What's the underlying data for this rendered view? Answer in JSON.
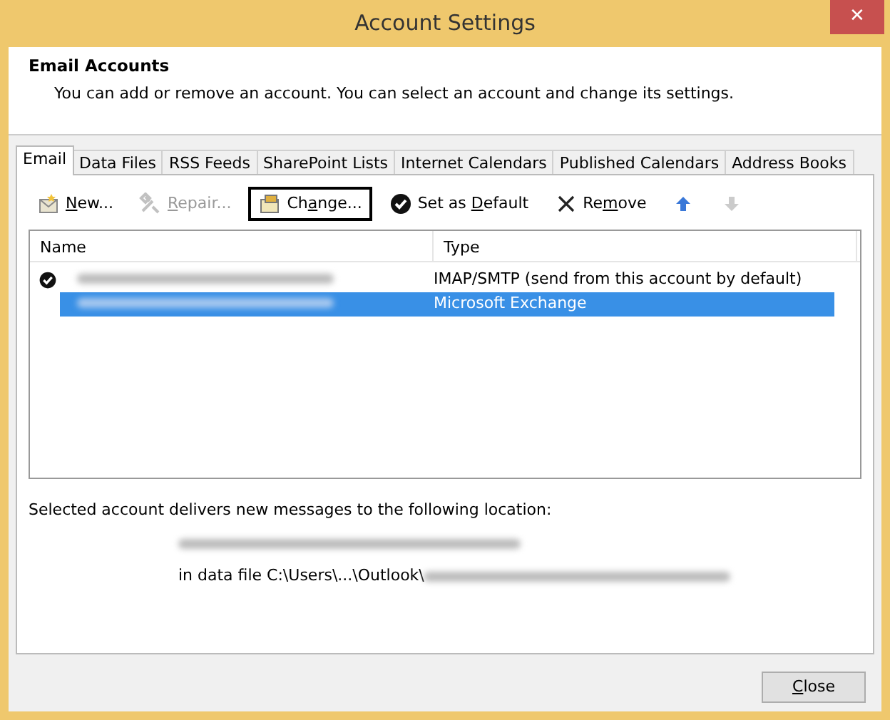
{
  "window": {
    "title": "Account Settings",
    "close_glyph": "✕"
  },
  "header": {
    "title": "Email Accounts",
    "description": "You can add or remove an account. You can select an account and change its settings."
  },
  "tabs": [
    {
      "label": "Email",
      "selected": true
    },
    {
      "label": "Data Files",
      "selected": false
    },
    {
      "label": "RSS Feeds",
      "selected": false
    },
    {
      "label": "SharePoint Lists",
      "selected": false
    },
    {
      "label": "Internet Calendars",
      "selected": false
    },
    {
      "label": "Published Calendars",
      "selected": false
    },
    {
      "label": "Address Books",
      "selected": false
    }
  ],
  "toolbar": [
    {
      "kind": "new",
      "label_parts": {
        "key": "N",
        "after": "ew..."
      },
      "disabled": false,
      "focused": false
    },
    {
      "kind": "repair",
      "label_parts": {
        "key": "R",
        "after": "epair..."
      },
      "disabled": true,
      "focused": false
    },
    {
      "kind": "change",
      "label_parts": {
        "before": "Ch",
        "key": "a",
        "after": "nge..."
      },
      "disabled": false,
      "focused": true
    },
    {
      "kind": "default",
      "label_parts": {
        "before": "Set as ",
        "key": "D",
        "after": "efault"
      },
      "disabled": false,
      "focused": false
    },
    {
      "kind": "remove",
      "label_parts": {
        "before": "Re",
        "key": "m",
        "after": "ove"
      },
      "disabled": false,
      "focused": false
    },
    {
      "kind": "up",
      "disabled": false,
      "focused": false
    },
    {
      "kind": "down",
      "disabled": true,
      "focused": false
    }
  ],
  "accounts": {
    "columns": [
      "Name",
      "Type"
    ],
    "rows": [
      {
        "default": true,
        "selected": false,
        "type": "IMAP/SMTP (send from this account by default)"
      },
      {
        "default": false,
        "selected": true,
        "type": "Microsoft Exchange"
      }
    ]
  },
  "location": {
    "text": "Selected account delivers new messages to the following location:",
    "data_file_prefix": "in data file C:\\Users\\...\\Outlook\\"
  },
  "buttons": [
    {
      "label_parts": {
        "key": "C",
        "after": "lose"
      }
    }
  ]
}
